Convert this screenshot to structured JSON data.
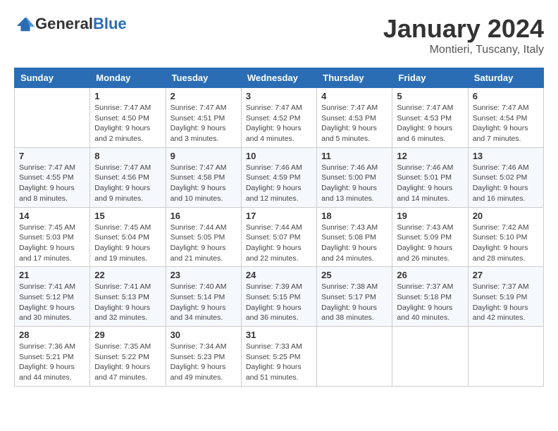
{
  "header": {
    "logo_general": "General",
    "logo_blue": "Blue",
    "title": "January 2024",
    "subtitle": "Montieri, Tuscany, Italy"
  },
  "columns": [
    "Sunday",
    "Monday",
    "Tuesday",
    "Wednesday",
    "Thursday",
    "Friday",
    "Saturday"
  ],
  "weeks": [
    [
      {
        "day": "",
        "sunrise": "",
        "sunset": "",
        "daylight": ""
      },
      {
        "day": "1",
        "sunrise": "Sunrise: 7:47 AM",
        "sunset": "Sunset: 4:50 PM",
        "daylight": "Daylight: 9 hours and 2 minutes."
      },
      {
        "day": "2",
        "sunrise": "Sunrise: 7:47 AM",
        "sunset": "Sunset: 4:51 PM",
        "daylight": "Daylight: 9 hours and 3 minutes."
      },
      {
        "day": "3",
        "sunrise": "Sunrise: 7:47 AM",
        "sunset": "Sunset: 4:52 PM",
        "daylight": "Daylight: 9 hours and 4 minutes."
      },
      {
        "day": "4",
        "sunrise": "Sunrise: 7:47 AM",
        "sunset": "Sunset: 4:53 PM",
        "daylight": "Daylight: 9 hours and 5 minutes."
      },
      {
        "day": "5",
        "sunrise": "Sunrise: 7:47 AM",
        "sunset": "Sunset: 4:53 PM",
        "daylight": "Daylight: 9 hours and 6 minutes."
      },
      {
        "day": "6",
        "sunrise": "Sunrise: 7:47 AM",
        "sunset": "Sunset: 4:54 PM",
        "daylight": "Daylight: 9 hours and 7 minutes."
      }
    ],
    [
      {
        "day": "7",
        "sunrise": "Sunrise: 7:47 AM",
        "sunset": "Sunset: 4:55 PM",
        "daylight": "Daylight: 9 hours and 8 minutes."
      },
      {
        "day": "8",
        "sunrise": "Sunrise: 7:47 AM",
        "sunset": "Sunset: 4:56 PM",
        "daylight": "Daylight: 9 hours and 9 minutes."
      },
      {
        "day": "9",
        "sunrise": "Sunrise: 7:47 AM",
        "sunset": "Sunset: 4:58 PM",
        "daylight": "Daylight: 9 hours and 10 minutes."
      },
      {
        "day": "10",
        "sunrise": "Sunrise: 7:46 AM",
        "sunset": "Sunset: 4:59 PM",
        "daylight": "Daylight: 9 hours and 12 minutes."
      },
      {
        "day": "11",
        "sunrise": "Sunrise: 7:46 AM",
        "sunset": "Sunset: 5:00 PM",
        "daylight": "Daylight: 9 hours and 13 minutes."
      },
      {
        "day": "12",
        "sunrise": "Sunrise: 7:46 AM",
        "sunset": "Sunset: 5:01 PM",
        "daylight": "Daylight: 9 hours and 14 minutes."
      },
      {
        "day": "13",
        "sunrise": "Sunrise: 7:46 AM",
        "sunset": "Sunset: 5:02 PM",
        "daylight": "Daylight: 9 hours and 16 minutes."
      }
    ],
    [
      {
        "day": "14",
        "sunrise": "Sunrise: 7:45 AM",
        "sunset": "Sunset: 5:03 PM",
        "daylight": "Daylight: 9 hours and 17 minutes."
      },
      {
        "day": "15",
        "sunrise": "Sunrise: 7:45 AM",
        "sunset": "Sunset: 5:04 PM",
        "daylight": "Daylight: 9 hours and 19 minutes."
      },
      {
        "day": "16",
        "sunrise": "Sunrise: 7:44 AM",
        "sunset": "Sunset: 5:05 PM",
        "daylight": "Daylight: 9 hours and 21 minutes."
      },
      {
        "day": "17",
        "sunrise": "Sunrise: 7:44 AM",
        "sunset": "Sunset: 5:07 PM",
        "daylight": "Daylight: 9 hours and 22 minutes."
      },
      {
        "day": "18",
        "sunrise": "Sunrise: 7:43 AM",
        "sunset": "Sunset: 5:08 PM",
        "daylight": "Daylight: 9 hours and 24 minutes."
      },
      {
        "day": "19",
        "sunrise": "Sunrise: 7:43 AM",
        "sunset": "Sunset: 5:09 PM",
        "daylight": "Daylight: 9 hours and 26 minutes."
      },
      {
        "day": "20",
        "sunrise": "Sunrise: 7:42 AM",
        "sunset": "Sunset: 5:10 PM",
        "daylight": "Daylight: 9 hours and 28 minutes."
      }
    ],
    [
      {
        "day": "21",
        "sunrise": "Sunrise: 7:41 AM",
        "sunset": "Sunset: 5:12 PM",
        "daylight": "Daylight: 9 hours and 30 minutes."
      },
      {
        "day": "22",
        "sunrise": "Sunrise: 7:41 AM",
        "sunset": "Sunset: 5:13 PM",
        "daylight": "Daylight: 9 hours and 32 minutes."
      },
      {
        "day": "23",
        "sunrise": "Sunrise: 7:40 AM",
        "sunset": "Sunset: 5:14 PM",
        "daylight": "Daylight: 9 hours and 34 minutes."
      },
      {
        "day": "24",
        "sunrise": "Sunrise: 7:39 AM",
        "sunset": "Sunset: 5:15 PM",
        "daylight": "Daylight: 9 hours and 36 minutes."
      },
      {
        "day": "25",
        "sunrise": "Sunrise: 7:38 AM",
        "sunset": "Sunset: 5:17 PM",
        "daylight": "Daylight: 9 hours and 38 minutes."
      },
      {
        "day": "26",
        "sunrise": "Sunrise: 7:37 AM",
        "sunset": "Sunset: 5:18 PM",
        "daylight": "Daylight: 9 hours and 40 minutes."
      },
      {
        "day": "27",
        "sunrise": "Sunrise: 7:37 AM",
        "sunset": "Sunset: 5:19 PM",
        "daylight": "Daylight: 9 hours and 42 minutes."
      }
    ],
    [
      {
        "day": "28",
        "sunrise": "Sunrise: 7:36 AM",
        "sunset": "Sunset: 5:21 PM",
        "daylight": "Daylight: 9 hours and 44 minutes."
      },
      {
        "day": "29",
        "sunrise": "Sunrise: 7:35 AM",
        "sunset": "Sunset: 5:22 PM",
        "daylight": "Daylight: 9 hours and 47 minutes."
      },
      {
        "day": "30",
        "sunrise": "Sunrise: 7:34 AM",
        "sunset": "Sunset: 5:23 PM",
        "daylight": "Daylight: 9 hours and 49 minutes."
      },
      {
        "day": "31",
        "sunrise": "Sunrise: 7:33 AM",
        "sunset": "Sunset: 5:25 PM",
        "daylight": "Daylight: 9 hours and 51 minutes."
      },
      {
        "day": "",
        "sunrise": "",
        "sunset": "",
        "daylight": ""
      },
      {
        "day": "",
        "sunrise": "",
        "sunset": "",
        "daylight": ""
      },
      {
        "day": "",
        "sunrise": "",
        "sunset": "",
        "daylight": ""
      }
    ]
  ]
}
